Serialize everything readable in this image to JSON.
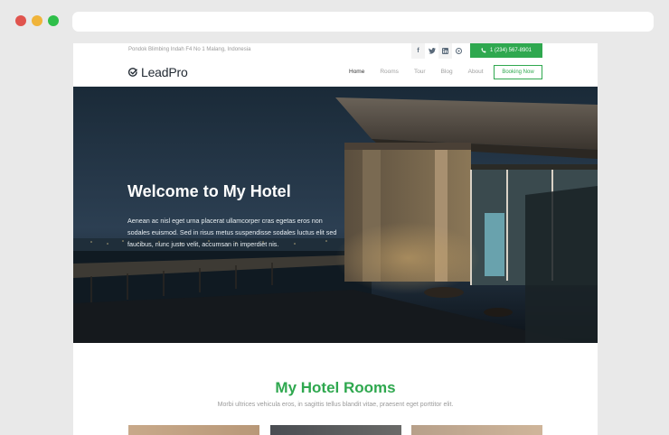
{
  "browser": {
    "dots": [
      "#e0544e",
      "#f0b43a",
      "#2fbf4a"
    ],
    "url": ""
  },
  "topbar": {
    "address": "Pondok Blimbing Indah F4 No 1 Malang, Indonesia",
    "socials": [
      "f",
      "t",
      "in",
      "◎"
    ],
    "phone": "1 (234) 567-8901"
  },
  "brand": {
    "logo_text": "LeadPro"
  },
  "nav": {
    "items": [
      "Home",
      "Rooms",
      "Tour",
      "Blog",
      "About"
    ],
    "booking_label": "Booking Now"
  },
  "hero": {
    "title": "Welcome to My Hotel",
    "text": "Aenean ac nisl eget urna placerat ullamcorper cras egetas eros non sodales euismod. Sed in risus metus suspendisse sodales luctus elit sed faucibus, nunc justo velit, accumsan in imperdiet nis."
  },
  "rooms": {
    "title": "My Hotel Rooms",
    "subtitle": "Morbi ultrices vehicula eros, in sagittis tellus blandit vitae, praesent eget porttitor elit."
  },
  "colors": {
    "accent": "#2fa84f",
    "page_bg": "#e9e9e9"
  }
}
